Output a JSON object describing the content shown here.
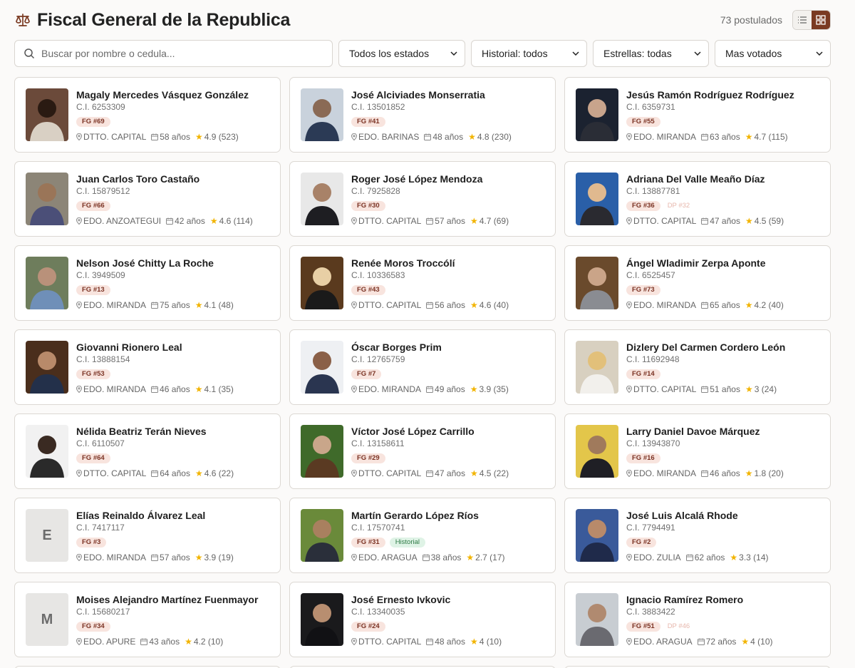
{
  "header": {
    "title": "Fiscal General de la Republica",
    "count": "73 postulados",
    "icons": [
      "scales-icon",
      "list-view-icon",
      "grid-view-icon"
    ],
    "accent": "#7a3a22"
  },
  "filters": {
    "search_placeholder": "Buscar por nombre o cedula...",
    "estado": "Todos los estados",
    "historial": "Historial: todos",
    "estrellas": "Estrellas: todas",
    "orden": "Mas votados"
  },
  "candidates": [
    {
      "name": "Magaly Mercedes Vásquez González",
      "ci": "C.I. 6253309",
      "badges": [
        "FG #69"
      ],
      "extra": "",
      "extra_type": "",
      "location": "DTTO. CAPITAL",
      "age": "58 años",
      "rating": "4.9 (523)",
      "photo": "photo",
      "initial": "",
      "bg": "#6b4a3a",
      "fg": "#2a1a12",
      "shirt": "#d9d0c4"
    },
    {
      "name": "José Alciviades Monserratia",
      "ci": "C.I. 13501852",
      "badges": [
        "FG #41"
      ],
      "extra": "",
      "extra_type": "",
      "location": "EDO. BARINAS",
      "age": "48 años",
      "rating": "4.8 (230)",
      "photo": "photo",
      "initial": "",
      "bg": "#c9d2dc",
      "fg": "#8a6a55",
      "shirt": "#2b3a55"
    },
    {
      "name": "Jesús Ramón Rodríguez Rodríguez",
      "ci": "C.I. 6359731",
      "badges": [
        "FG #55"
      ],
      "extra": "",
      "extra_type": "",
      "location": "EDO. MIRANDA",
      "age": "63 años",
      "rating": "4.7 (115)",
      "photo": "photo",
      "initial": "",
      "bg": "#1b2230",
      "fg": "#c8a48c",
      "shirt": "#2a2d36"
    },
    {
      "name": "Juan Carlos Toro Castaño",
      "ci": "C.I. 15879512",
      "badges": [
        "FG #66"
      ],
      "extra": "",
      "extra_type": "",
      "location": "EDO. ANZOATEGUI",
      "age": "42 años",
      "rating": "4.6 (114)",
      "photo": "photo",
      "initial": "",
      "bg": "#8c8577",
      "fg": "#9a7558",
      "shirt": "#4b4f78"
    },
    {
      "name": "Roger José López Mendoza",
      "ci": "C.I. 7925828",
      "badges": [
        "FG #30"
      ],
      "extra": "",
      "extra_type": "",
      "location": "DTTO. CAPITAL",
      "age": "57 años",
      "rating": "4.7 (69)",
      "photo": "photo",
      "initial": "",
      "bg": "#e8e8e8",
      "fg": "#a88268",
      "shirt": "#1e1e22"
    },
    {
      "name": "Adriana Del Valle Meaño Díaz",
      "ci": "C.I. 13887781",
      "badges": [
        "FG #36"
      ],
      "extra": "DP #32",
      "extra_type": "faint",
      "location": "DTTO. CAPITAL",
      "age": "47 años",
      "rating": "4.5 (59)",
      "photo": "photo",
      "initial": "",
      "bg": "#2a5fa8",
      "fg": "#e0b98f",
      "shirt": "#2a2a30"
    },
    {
      "name": "Nelson José Chitty La Roche",
      "ci": "C.I. 3949509",
      "badges": [
        "FG #13"
      ],
      "extra": "",
      "extra_type": "",
      "location": "EDO. MIRANDA",
      "age": "75 años",
      "rating": "4.1 (48)",
      "photo": "photo",
      "initial": "",
      "bg": "#6e7d5c",
      "fg": "#b9917a",
      "shirt": "#6f8fb8"
    },
    {
      "name": "Renée Moros Troccólí",
      "ci": "C.I. 10336583",
      "badges": [
        "FG #43"
      ],
      "extra": "",
      "extra_type": "",
      "location": "DTTO. CAPITAL",
      "age": "56 años",
      "rating": "4.6 (40)",
      "photo": "photo",
      "initial": "",
      "bg": "#5a3a1e",
      "fg": "#e8cfa5",
      "shirt": "#1a1a1a"
    },
    {
      "name": "Ángel Wladimir Zerpa Aponte",
      "ci": "C.I. 6525457",
      "badges": [
        "FG #73"
      ],
      "extra": "",
      "extra_type": "",
      "location": "EDO. MIRANDA",
      "age": "65 años",
      "rating": "4.2 (40)",
      "photo": "photo",
      "initial": "",
      "bg": "#6a4a2c",
      "fg": "#caa488",
      "shirt": "#8a8c92"
    },
    {
      "name": "Giovanni Rionero Leal",
      "ci": "C.I. 13888154",
      "badges": [
        "FG #53"
      ],
      "extra": "",
      "extra_type": "",
      "location": "EDO. MIRANDA",
      "age": "46 años",
      "rating": "4.1 (35)",
      "photo": "photo",
      "initial": "",
      "bg": "#4a2e1c",
      "fg": "#b88a6a",
      "shirt": "#23304a"
    },
    {
      "name": "Óscar Borges Prim",
      "ci": "C.I. 12765759",
      "badges": [
        "FG #7"
      ],
      "extra": "",
      "extra_type": "",
      "location": "EDO. MIRANDA",
      "age": "49 años",
      "rating": "3.9 (35)",
      "photo": "photo",
      "initial": "",
      "bg": "#eef0f3",
      "fg": "#8a6048",
      "shirt": "#2a3550"
    },
    {
      "name": "Dizlery Del Carmen Cordero León",
      "ci": "C.I. 11692948",
      "badges": [
        "FG #14"
      ],
      "extra": "",
      "extra_type": "",
      "location": "DTTO. CAPITAL",
      "age": "51 años",
      "rating": "3 (24)",
      "photo": "photo",
      "initial": "",
      "bg": "#d8d0c0",
      "fg": "#e2c07a",
      "shirt": "#f2f0ec"
    },
    {
      "name": "Nélida Beatriz Terán Nieves",
      "ci": "C.I. 6110507",
      "badges": [
        "FG #64"
      ],
      "extra": "",
      "extra_type": "",
      "location": "DTTO. CAPITAL",
      "age": "64 años",
      "rating": "4.6 (22)",
      "photo": "photo",
      "initial": "",
      "bg": "#f1f1f1",
      "fg": "#3a2a22",
      "shirt": "#2a2a2a"
    },
    {
      "name": "Víctor José López Carrillo",
      "ci": "C.I. 13158611",
      "badges": [
        "FG #29"
      ],
      "extra": "",
      "extra_type": "",
      "location": "DTTO. CAPITAL",
      "age": "47 años",
      "rating": "4.5 (22)",
      "photo": "photo",
      "initial": "",
      "bg": "#3f6a2a",
      "fg": "#c9a68a",
      "shirt": "#5a3a22"
    },
    {
      "name": "Larry Daniel Davoe Márquez",
      "ci": "C.I. 13943870",
      "badges": [
        "FG #16"
      ],
      "extra": "",
      "extra_type": "",
      "location": "EDO. MIRANDA",
      "age": "46 años",
      "rating": "1.8 (20)",
      "photo": "photo",
      "initial": "",
      "bg": "#e3c64a",
      "fg": "#a07a5c",
      "shirt": "#1f1f25"
    },
    {
      "name": "Elías Reinaldo Álvarez Leal",
      "ci": "C.I. 7417117",
      "badges": [
        "FG #3"
      ],
      "extra": "",
      "extra_type": "",
      "location": "EDO. MIRANDA",
      "age": "57 años",
      "rating": "3.9 (19)",
      "photo": "initial",
      "initial": "E",
      "bg": "",
      "fg": "",
      "shirt": ""
    },
    {
      "name": "Martín Gerardo López Ríos",
      "ci": "C.I. 17570741",
      "badges": [
        "FG #31"
      ],
      "extra": "Historial",
      "extra_type": "green",
      "location": "EDO. ARAGUA",
      "age": "38 años",
      "rating": "2.7 (17)",
      "photo": "photo",
      "initial": "",
      "bg": "#6a8a3a",
      "fg": "#a9805f",
      "shirt": "#2a2f3a"
    },
    {
      "name": "José Luis Alcalá Rhode",
      "ci": "C.I. 7794491",
      "badges": [
        "FG #2"
      ],
      "extra": "",
      "extra_type": "",
      "location": "EDO. ZULIA",
      "age": "62 años",
      "rating": "3.3 (14)",
      "photo": "photo",
      "initial": "",
      "bg": "#3a5a9a",
      "fg": "#b88a6a",
      "shirt": "#1f2a4a"
    },
    {
      "name": "Moises Alejandro Martínez Fuenmayor",
      "ci": "C.I. 15680217",
      "badges": [
        "FG #34"
      ],
      "extra": "",
      "extra_type": "",
      "location": "EDO. APURE",
      "age": "43 años",
      "rating": "4.2 (10)",
      "photo": "initial",
      "initial": "M",
      "bg": "",
      "fg": "",
      "shirt": ""
    },
    {
      "name": "José Ernesto Ivkovic",
      "ci": "C.I. 13340035",
      "badges": [
        "FG #24"
      ],
      "extra": "",
      "extra_type": "",
      "location": "DTTO. CAPITAL",
      "age": "48 años",
      "rating": "4 (10)",
      "photo": "photo",
      "initial": "",
      "bg": "#1a1a1c",
      "fg": "#b88e70",
      "shirt": "#111114"
    },
    {
      "name": "Ignacio Ramírez Romero",
      "ci": "C.I. 3883422",
      "badges": [
        "FG #51"
      ],
      "extra": "DP #46",
      "extra_type": "faint",
      "location": "EDO. ARAGUA",
      "age": "72 años",
      "rating": "4 (10)",
      "photo": "photo",
      "initial": "",
      "bg": "#c8cdd2",
      "fg": "#b08a70",
      "shirt": "#6a6a70"
    }
  ]
}
